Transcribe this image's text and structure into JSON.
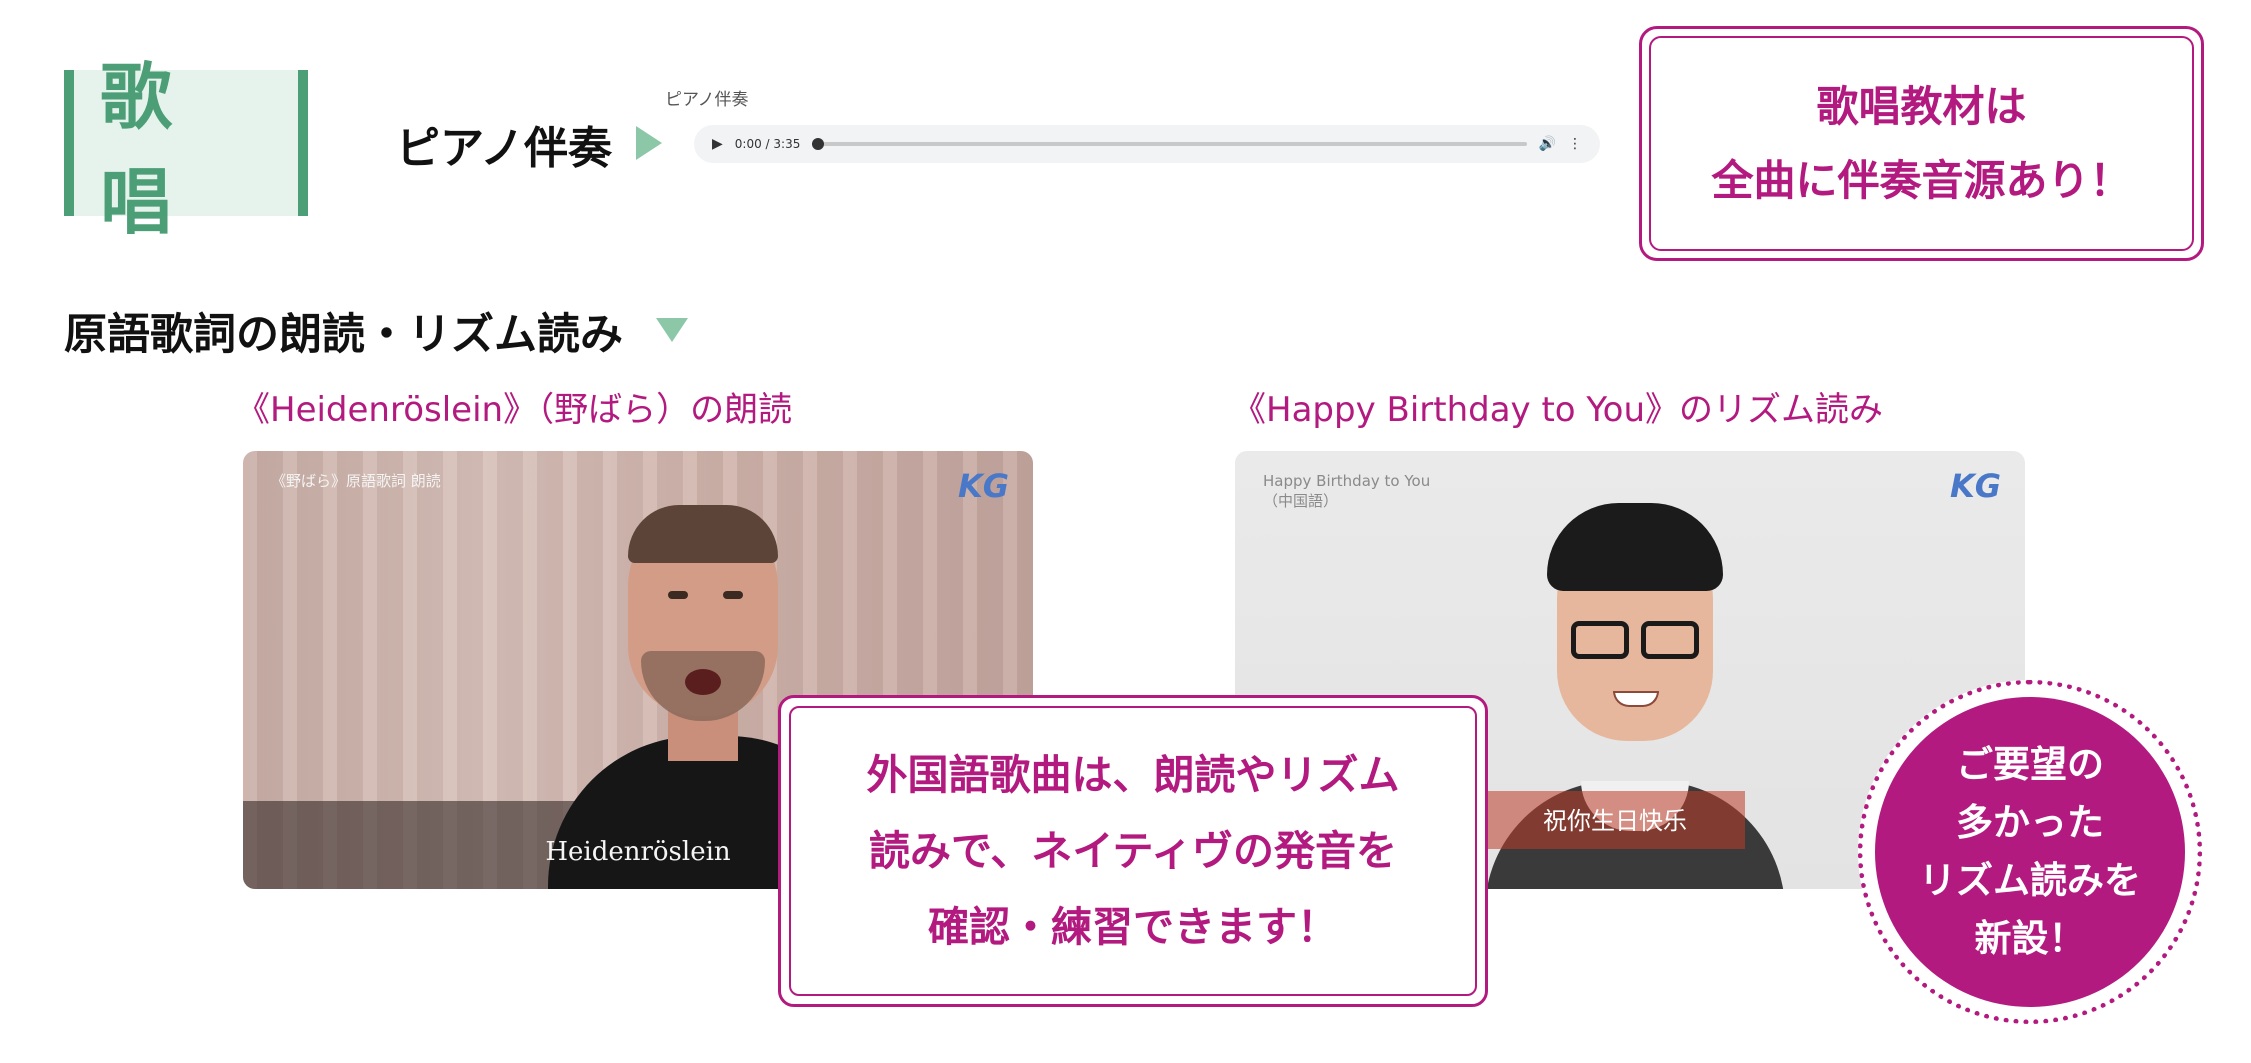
{
  "badge": {
    "label": "歌 唱"
  },
  "piano": {
    "label": "ピアノ伴奏",
    "audio_caption": "ピアノ伴奏",
    "player": {
      "time": "0:00 / 3:35",
      "play_icon": "play-icon",
      "volume_icon": "volume-icon",
      "menu_icon": "more-icon"
    }
  },
  "callout_top": {
    "line1": "歌唱教材は",
    "line2": "全曲に伴奏音源あり！"
  },
  "section": {
    "heading": "原語歌詞の朗読・リズム読み"
  },
  "videos": [
    {
      "caption": "《Heidenröslein》（野ばら）の朗読",
      "overlay": "《野ばら》原語歌詞 朗読",
      "logo": "KG",
      "subtitle": "Heidenröslein"
    },
    {
      "caption": "《Happy Birthday to You》のリズム読み",
      "overlay_line1": "Happy Birthday to You",
      "overlay_line2": "（中国語）",
      "logo": "KG",
      "subtitle": "祝你生日快乐"
    }
  ],
  "callout_center": {
    "line1": "外国語歌曲は、朗読やリズム",
    "line2": "読みで、ネイティヴの発音を",
    "line3": "確認・練習できます！"
  },
  "circle_badge": {
    "line1": "ご要望の",
    "line2": "多かった",
    "line3": "リズム読みを",
    "line4": "新設！"
  },
  "colors": {
    "green": "#4c9e76",
    "magenta": "#b31a7f",
    "triangle": "#8cc7a8"
  }
}
